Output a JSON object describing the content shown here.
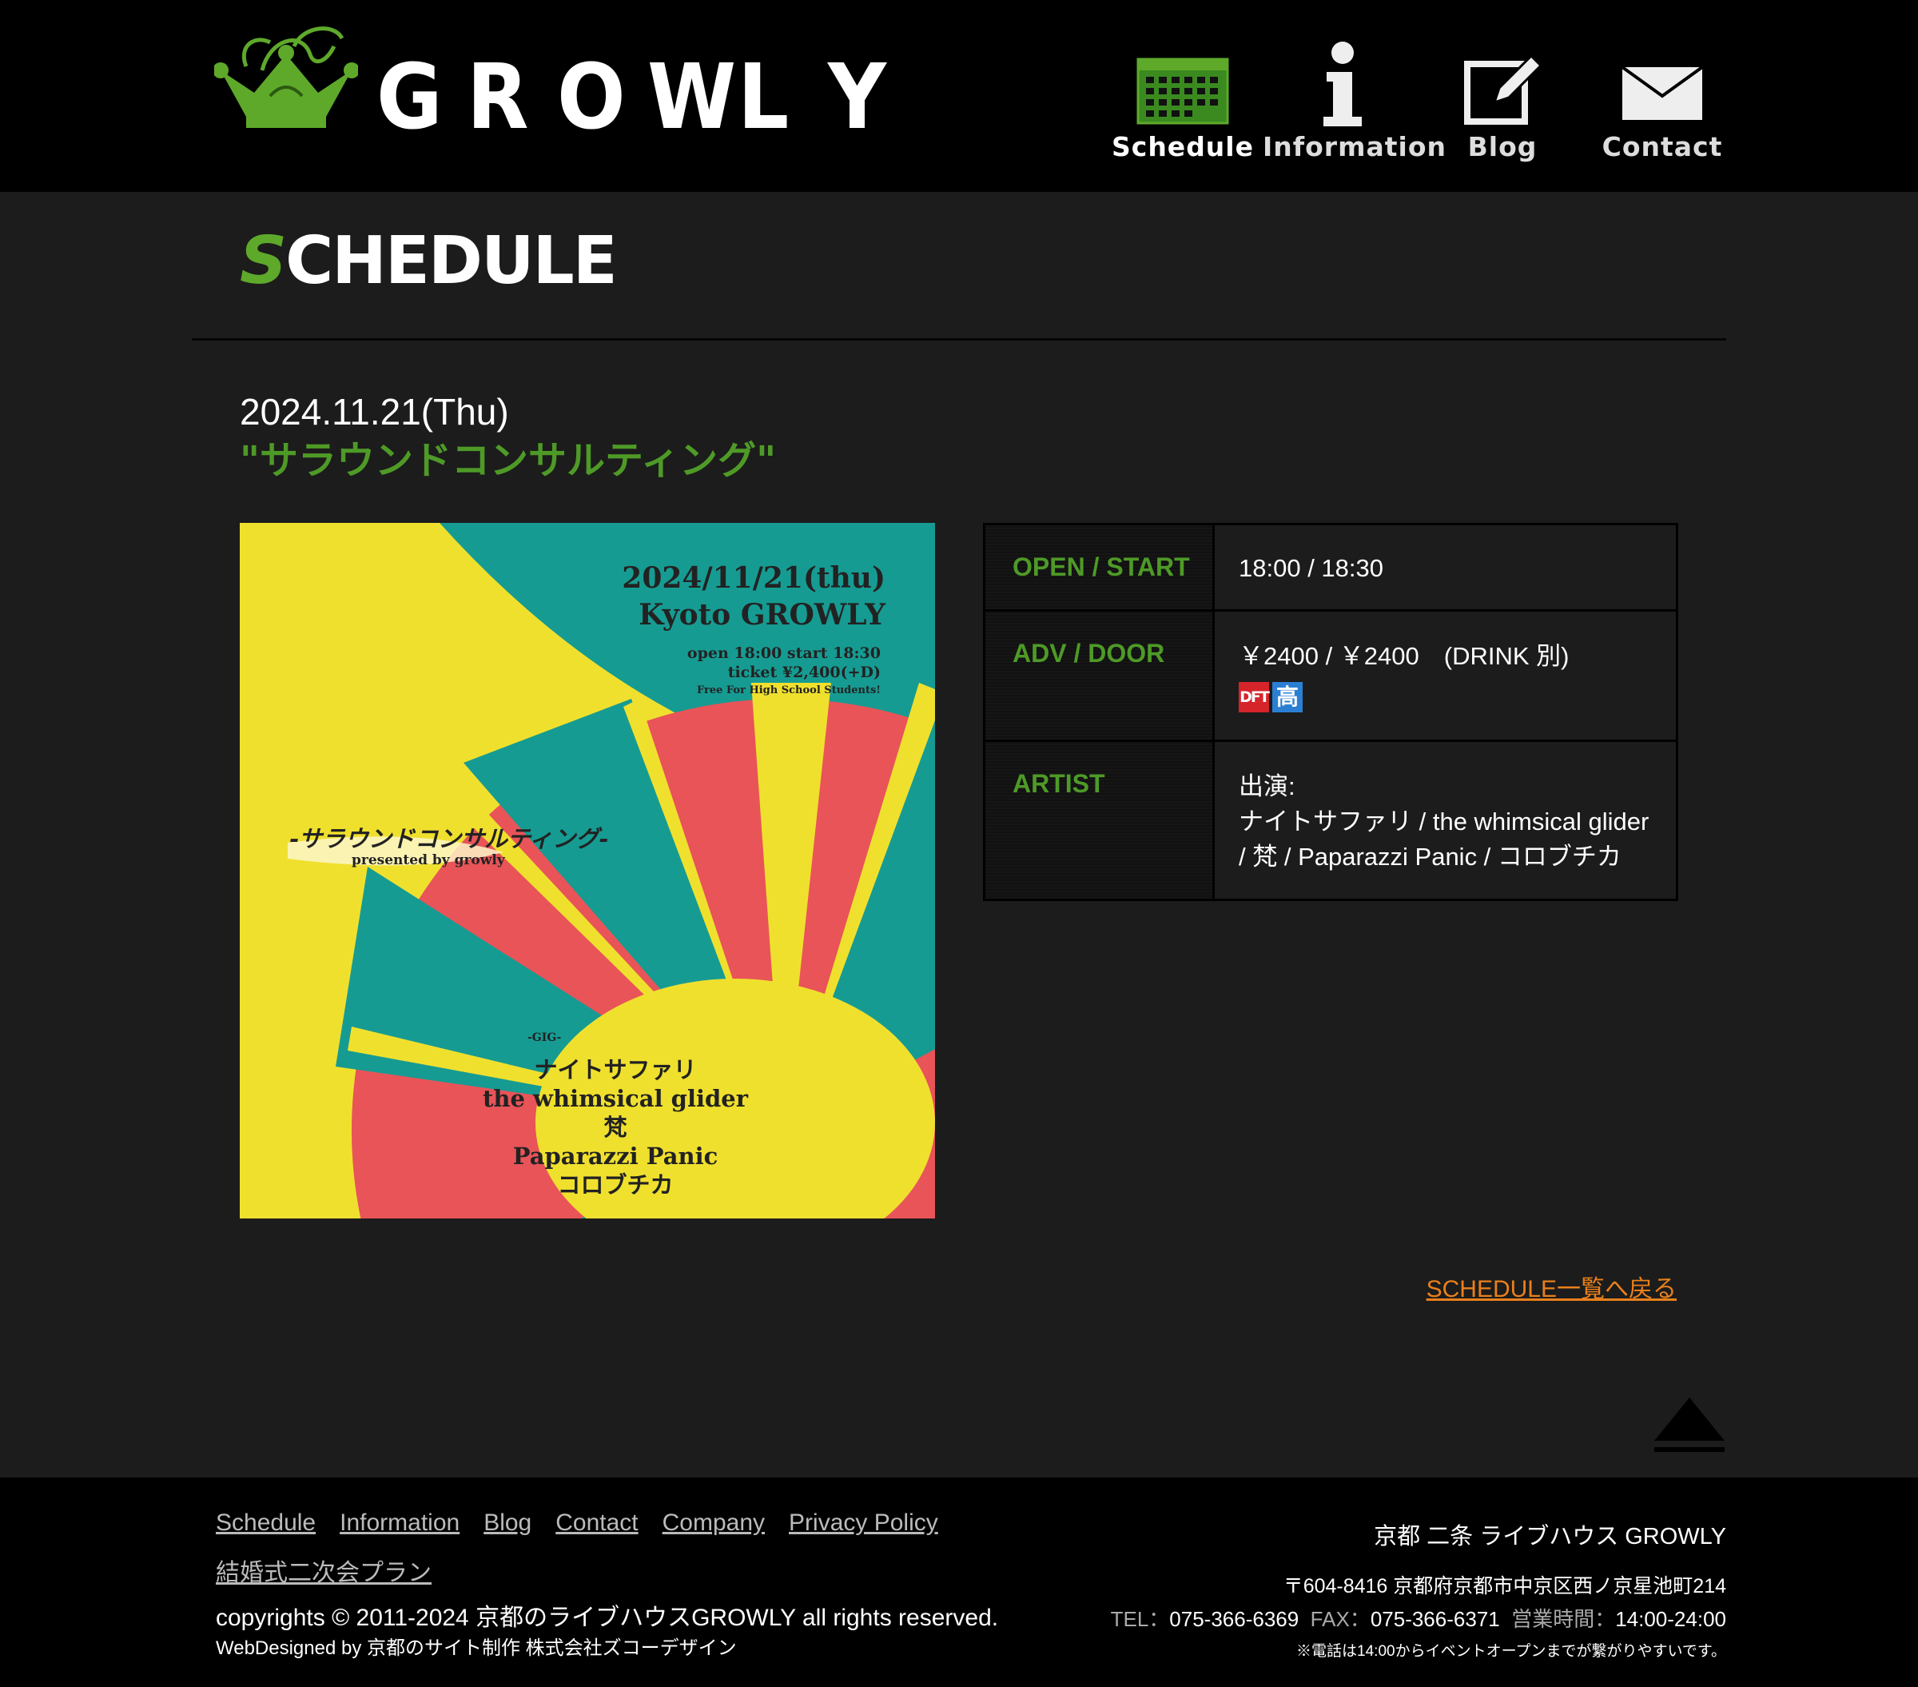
{
  "header": {
    "logo_text": [
      "G",
      "R",
      "O",
      "W",
      "L",
      "Y"
    ],
    "nav": [
      {
        "label": "Schedule",
        "icon": "calendar-icon"
      },
      {
        "label": "Information",
        "icon": "info-icon"
      },
      {
        "label": "Blog",
        "icon": "pencil-icon"
      },
      {
        "label": "Contact",
        "icon": "envelope-icon"
      }
    ]
  },
  "page": {
    "title_first": "S",
    "title_rest": "CHEDULE"
  },
  "event": {
    "date": "2024.11.21(Thu)",
    "name": "\"サラウンドコンサルティング\"",
    "flyer": {
      "date": "2024/11/21(thu)",
      "venue": "Kyoto GROWLY",
      "open_start": "open 18:00 start 18:30",
      "ticket": "ticket ¥2,400(+D)",
      "note": "Free For High School Students!",
      "title": "-サラウンドコンサルティング-",
      "presented": "presented by growly",
      "gig": "-GIG-",
      "artists": [
        "ナイトサファリ",
        "the whimsical glider",
        "梵",
        "Paparazzi Panic",
        "コロブチカ"
      ]
    },
    "table": {
      "open_label": "OPEN / START",
      "open_value": "18:00 / 18:30",
      "price_label": "ADV / DOOR",
      "price_value": "￥2400 / ￥2400　(DRINK 別)",
      "badge_dft": "DFT",
      "badge_hs": "高",
      "artist_label": "ARTIST",
      "artist_prefix": "出演:",
      "artist_line1": "ナイトサファリ / the whimsical glider",
      "artist_line2": "/ 梵 / Paparazzi Panic / コロブチカ"
    },
    "back_link": "SCHEDULE一覧へ戻る"
  },
  "footer": {
    "links": [
      "Schedule",
      "Information",
      "Blog",
      "Contact",
      "Company",
      "Privacy Policy",
      "結婚式二次会プラン"
    ],
    "copyright": "copyrights © 2011-2024 京都のライブハウスGROWLY all rights reserved.",
    "webdesign": "WebDesigned by 京都のサイト制作 株式会社ズコーデザイン",
    "venue_name": "京都 二条 ライブハウス GROWLY",
    "address": "〒604-8416 京都府京都市中京区西ノ京星池町214",
    "tel_label": "TEL：",
    "tel": "075-366-6369",
    "fax_label": "FAX：",
    "fax": "075-366-6371",
    "hours_label": "営業時間：",
    "hours": "14:00-24:00",
    "note": "※電話は14:00からイベントオープンまでが繋がりやすいです。"
  },
  "colors": {
    "accent_green": "#4e9a27",
    "link_orange": "#e8801c",
    "flyer_yellow": "#f0e02e",
    "flyer_teal": "#169b92",
    "flyer_red": "#e85458"
  }
}
